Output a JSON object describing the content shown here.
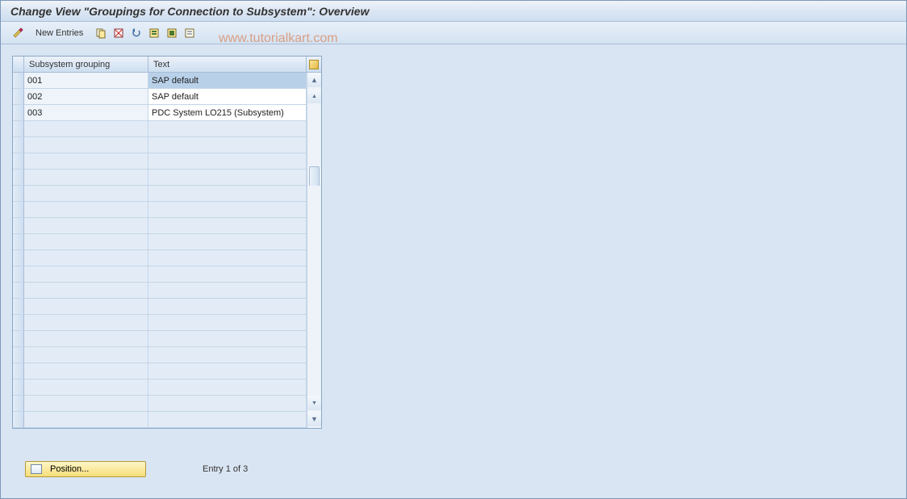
{
  "title": "Change View \"Groupings for Connection to Subsystem\": Overview",
  "toolbar": {
    "new_entries": "New Entries"
  },
  "watermark": "www.tutorialkart.com",
  "table": {
    "headers": {
      "col1": "Subsystem grouping",
      "col2": "Text"
    },
    "rows": [
      {
        "grp": "001",
        "text": "SAP default",
        "selected": true
      },
      {
        "grp": "002",
        "text": "SAP default",
        "selected": false
      },
      {
        "grp": "003",
        "text": "PDC System LO215 (Subsystem)",
        "selected": false
      }
    ],
    "empty_rows": 19
  },
  "footer": {
    "position_label": "Position...",
    "status": "Entry 1 of 3"
  }
}
